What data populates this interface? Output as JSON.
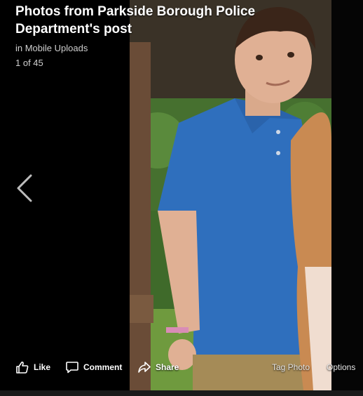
{
  "post": {
    "title": "Photos from Parkside Borough Police Department's post",
    "album": "in Mobile Uploads",
    "counter": "1 of 45"
  },
  "nav": {
    "prev_icon": "chevron-left-icon"
  },
  "actions": {
    "like": "Like",
    "comment": "Comment",
    "share": "Share",
    "tag_photo": "Tag Photo",
    "options": "Options"
  },
  "colors": {
    "background": "#000000",
    "shirt": "#2f6fbd",
    "foliage": "#3f6a2a",
    "text": "#ffffff"
  }
}
